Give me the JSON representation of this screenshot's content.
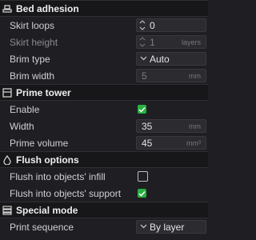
{
  "sections": {
    "bed_adhesion": {
      "title": "Bed adhesion",
      "icon": "bed-adhesion-icon",
      "skirt_loops": {
        "label": "Skirt loops",
        "value": "0"
      },
      "skirt_height": {
        "label": "Skirt height",
        "value": "1",
        "unit": "layers"
      },
      "brim_type": {
        "label": "Brim type",
        "value": "Auto"
      },
      "brim_width": {
        "label": "Brim width",
        "value": "5",
        "unit": "mm"
      }
    },
    "prime_tower": {
      "title": "Prime tower",
      "icon": "prime-tower-icon",
      "enable": {
        "label": "Enable",
        "checked": true
      },
      "width": {
        "label": "Width",
        "value": "35",
        "unit": "mm"
      },
      "prime_volume": {
        "label": "Prime volume",
        "value": "45",
        "unit": "mm³"
      }
    },
    "flush_options": {
      "title": "Flush options",
      "icon": "flush-options-icon",
      "infill": {
        "label": "Flush into objects' infill",
        "checked": false
      },
      "support": {
        "label": "Flush into objects' support",
        "checked": true
      }
    },
    "special_mode": {
      "title": "Special mode",
      "icon": "special-mode-icon",
      "print_sequence": {
        "label": "Print sequence",
        "value": "By layer"
      }
    }
  },
  "colors": {
    "accent_green": "#28b042",
    "background": "#1f1f23",
    "header_bg": "#17171a"
  }
}
